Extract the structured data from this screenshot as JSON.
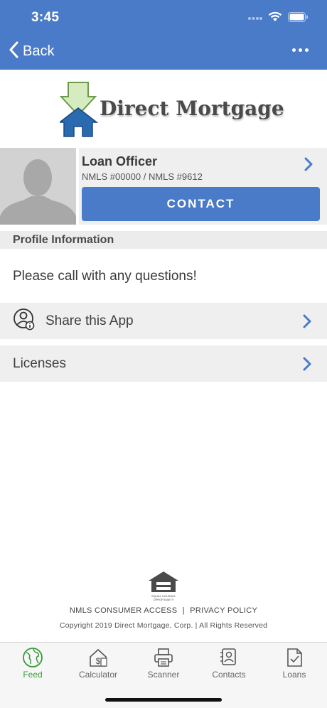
{
  "status_bar": {
    "time": "3:45"
  },
  "nav": {
    "back_label": "Back"
  },
  "logo": {
    "text": "Direct Mortgage"
  },
  "officer": {
    "name": "Loan Officer",
    "nmls": "NMLS #00000 / NMLS #9612",
    "contact_label": "CONTACT"
  },
  "profile": {
    "section_title": "Profile Information",
    "text": "Please call with any questions!"
  },
  "rows": {
    "share_label": "Share this App",
    "licenses_label": "Licenses"
  },
  "footer": {
    "ehl_text": "EQUAL HOUSING OPPORTUNITY",
    "nmls_link": "NMLS CONSUMER ACCESS",
    "separator": "|",
    "privacy_link": "PRIVACY POLICY",
    "copyright": "Copyright 2019 Direct Mortgage, Corp. | All Rights Reserved"
  },
  "tabs": [
    {
      "label": "Feed",
      "icon": "globe-icon",
      "active": true
    },
    {
      "label": "Calculator",
      "icon": "calculator-icon",
      "active": false
    },
    {
      "label": "Scanner",
      "icon": "printer-icon",
      "active": false
    },
    {
      "label": "Contacts",
      "icon": "contacts-icon",
      "active": false
    },
    {
      "label": "Loans",
      "icon": "document-icon",
      "active": false
    }
  ],
  "colors": {
    "brand_blue": "#4a7bc8",
    "active_tab": "#3a9a3a",
    "row_bg": "#efefef"
  }
}
